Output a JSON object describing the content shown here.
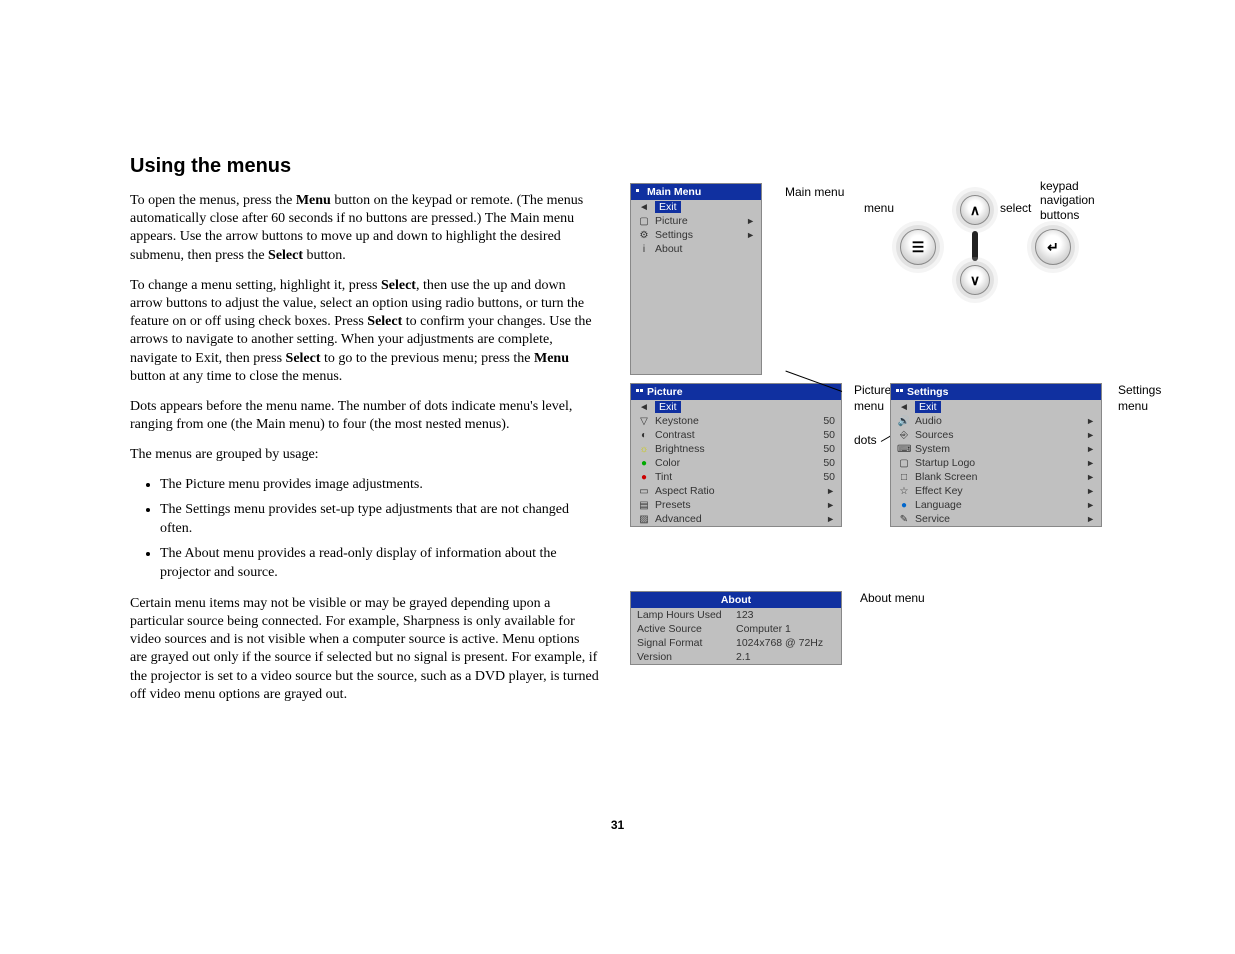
{
  "heading": "Using the menus",
  "paragraphs": {
    "p1a": "To open the menus, press the ",
    "p1b": " button on the keypad or remote. (The menus automatically close after 60 seconds if no buttons are pressed.) The Main menu appears. Use the arrow buttons to move up and down to highlight the desired submenu, then press the ",
    "p1c": " button.",
    "p2a": "To change a menu setting, highlight it, press ",
    "p2b": ", then use the up and down arrow buttons to adjust the value, select an option using radio buttons, or turn the feature on or off using check boxes. Press ",
    "p2c": " to confirm your changes. Use the arrows to navigate to another setting. When your adjustments are complete, navigate to Exit, then press ",
    "p2d": " to go to the previous menu; press the ",
    "p2e": " button at any time to close the menus.",
    "p3": "Dots appears before the menu name. The number of dots indicate menu's level, ranging from one (the Main menu) to four (the most nested menus).",
    "p4": "The menus are grouped by usage:",
    "p5": "Certain menu items may not be visible or may be grayed depending upon a particular source being connected. For example, Sharpness is only available for video sources and is not visible when a computer source is active. Menu options are grayed out only if the source if selected but no signal is present. For example, if the projector is set to a video source but the source, such as a DVD player, is turned off video menu options are grayed out."
  },
  "bold": {
    "menu": "Menu",
    "select": "Select"
  },
  "bullets": [
    "The Picture menu provides image adjustments.",
    "The Settings menu provides set-up type adjustments that are not changed often.",
    "The About menu provides a read-only display of information about the projector and source."
  ],
  "labels": {
    "main_menu": "Main menu",
    "keypad": "keypad navigation buttons",
    "menu_btn": "menu",
    "select_btn": "select",
    "picture_menu": "Picture menu",
    "settings_menu": "Settings menu",
    "dots": "dots",
    "about_menu": "About menu"
  },
  "main_menu": {
    "title": "Main Menu",
    "exit": "Exit",
    "items": [
      {
        "label": "Picture"
      },
      {
        "label": "Settings"
      },
      {
        "label": "About"
      }
    ]
  },
  "picture_menu": {
    "title": "Picture",
    "exit": "Exit",
    "items": [
      {
        "label": "Keystone",
        "value": "50"
      },
      {
        "label": "Contrast",
        "value": "50"
      },
      {
        "label": "Brightness",
        "value": "50"
      },
      {
        "label": "Color",
        "value": "50"
      },
      {
        "label": "Tint",
        "value": "50"
      },
      {
        "label": "Aspect Ratio",
        "arrow": true
      },
      {
        "label": "Presets",
        "arrow": true
      },
      {
        "label": "Advanced",
        "arrow": true
      }
    ]
  },
  "settings_menu": {
    "title": "Settings",
    "exit": "Exit",
    "items": [
      {
        "label": "Audio"
      },
      {
        "label": "Sources"
      },
      {
        "label": "System"
      },
      {
        "label": "Startup Logo"
      },
      {
        "label": "Blank Screen"
      },
      {
        "label": "Effect Key"
      },
      {
        "label": "Language"
      },
      {
        "label": "Service"
      }
    ]
  },
  "about_menu": {
    "title": "About",
    "rows": [
      {
        "k": "Lamp Hours Used",
        "v": "123"
      },
      {
        "k": "Active Source",
        "v": "Computer 1"
      },
      {
        "k": "Signal Format",
        "v": "1024x768 @ 72Hz"
      },
      {
        "k": "Version",
        "v": "2.1"
      }
    ]
  },
  "page_number": "31"
}
